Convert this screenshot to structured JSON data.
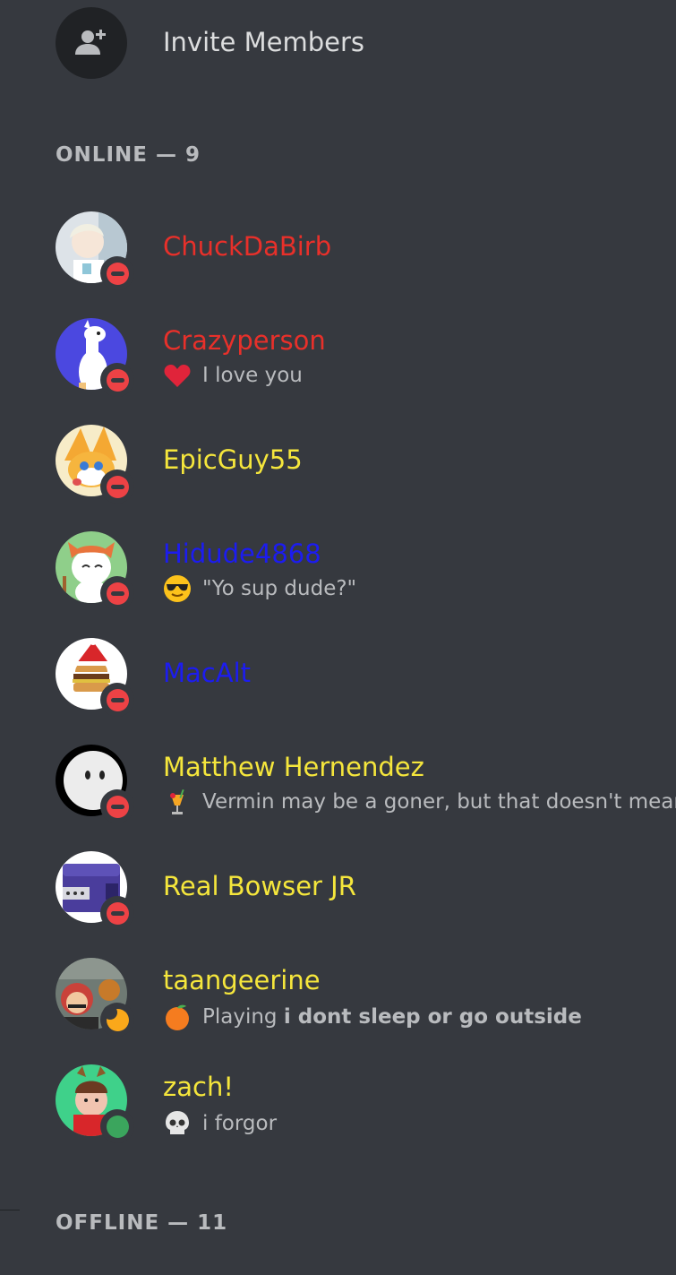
{
  "invite": {
    "label": "Invite Members",
    "icon": "add-user-icon"
  },
  "sections": {
    "online": "ONLINE — 9",
    "offline": "OFFLINE — 11"
  },
  "colors": {
    "background": "#36393f",
    "dnd": "#ed4245",
    "online": "#3ba55d",
    "idle": "#faa81a",
    "name_yellow": "#f5e63c",
    "name_red": "#e8302a",
    "name_blue": "#1c1cf0"
  },
  "members": [
    {
      "name": "ChuckDaBirb",
      "color": "red",
      "status": "dnd",
      "activity": ""
    },
    {
      "name": "Crazyperson",
      "color": "red",
      "status": "dnd",
      "activity_icon": "heart-emoji",
      "activity": "I love you"
    },
    {
      "name": "EpicGuy55",
      "color": "yellow",
      "status": "dnd",
      "activity": ""
    },
    {
      "name": "Hidude4868",
      "color": "blue",
      "status": "dnd",
      "activity_icon": "sunglasses-emoji",
      "activity": "\"Yo sup dude?\""
    },
    {
      "name": "MacAlt",
      "color": "blue",
      "status": "dnd",
      "activity": ""
    },
    {
      "name": "Matthew Hernendez",
      "color": "yellow",
      "status": "dnd",
      "activity_icon": "tropical-drink-emoji",
      "activity": "Vermin may be a goner, but that doesn't mean..."
    },
    {
      "name": "Real Bowser JR",
      "color": "yellow",
      "status": "dnd",
      "activity": ""
    },
    {
      "name": "taangeerine",
      "color": "yellow",
      "status": "idle",
      "activity_icon": "tangerine-emoji",
      "activity_prefix": "Playing",
      "activity": "i dont sleep or go outside"
    },
    {
      "name": "zach!",
      "color": "yellow",
      "status": "online",
      "activity_icon": "skull-emoji",
      "activity": "i forgor"
    }
  ]
}
